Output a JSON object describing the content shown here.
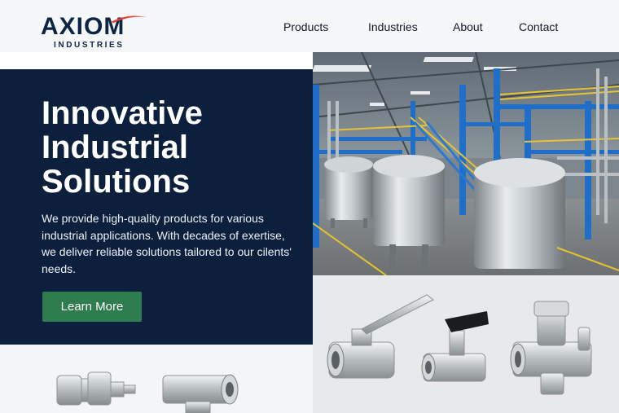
{
  "brand": {
    "name": "AXIOM",
    "subtitle": "INDUSTRIES"
  },
  "nav": {
    "items": [
      "Products",
      "Industries",
      "About",
      "Contact"
    ]
  },
  "hero": {
    "title_lines": [
      "Innovative",
      "Industrial",
      "Solutions"
    ],
    "description": "We provide high-quality products for various industrial applications. With decades of exertise, we deliver reliable solutions tailored to our cilents' needs.",
    "cta_label": "Learn More"
  },
  "colors": {
    "navy": "#0c1f3d",
    "cta_green": "#2f7d4f",
    "accent_red": "#e2403a",
    "steel_blue": "#1f6fc8"
  }
}
